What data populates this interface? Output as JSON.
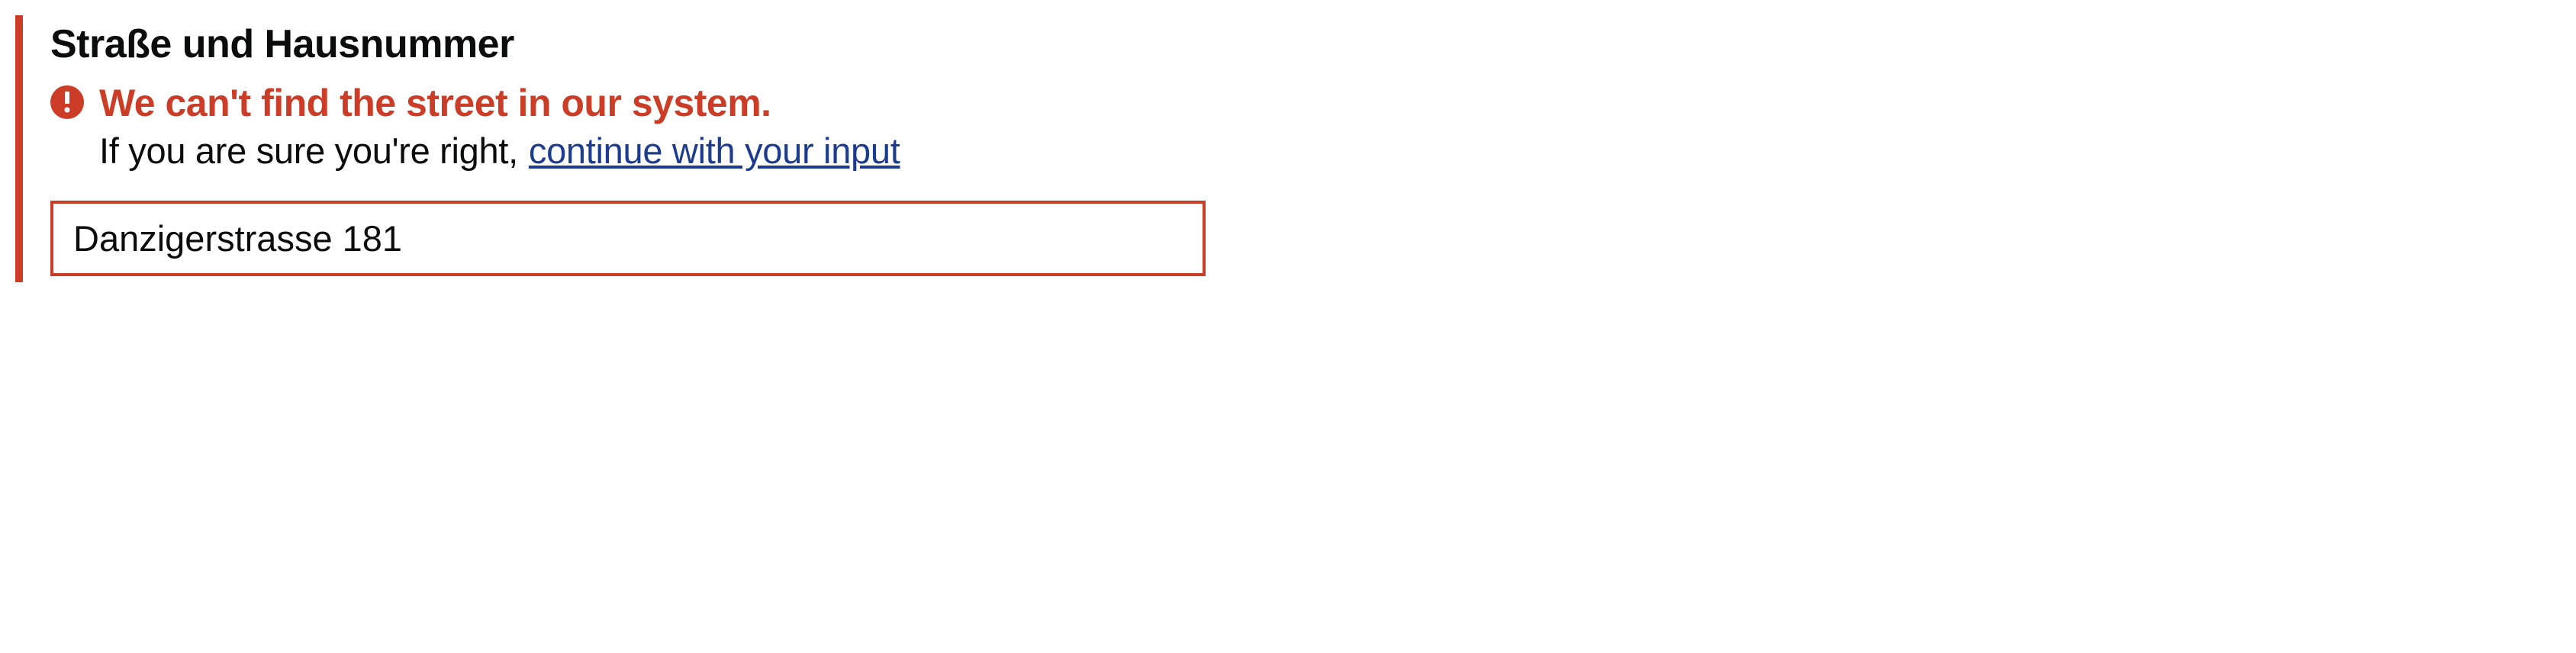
{
  "field": {
    "label": "Straße und Hausnummer",
    "value": "Danzigerstrasse 181"
  },
  "error": {
    "title": "We can't find the street in our system.",
    "hint_prefix": "If you are sure you're right,",
    "hint_link": "continue with your input"
  }
}
